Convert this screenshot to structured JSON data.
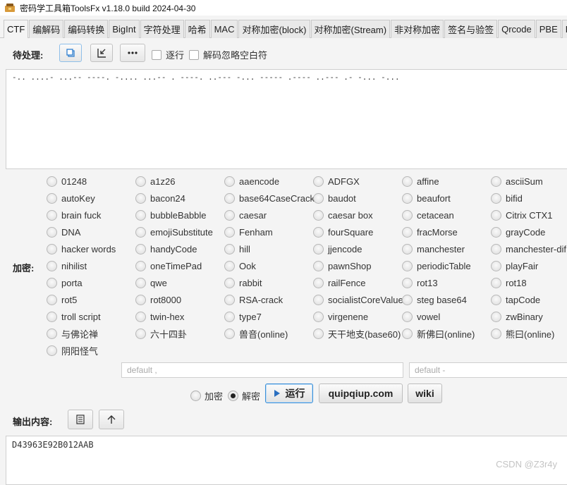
{
  "window": {
    "title": "密码学工具箱ToolsFx v1.18.0 build 2024-04-30"
  },
  "tabs": [
    "CTF",
    "编解码",
    "编码转换",
    "BigInt",
    "字符处理",
    "哈希",
    "MAC",
    "对称加密(block)",
    "对称加密(Stream)",
    "非对称加密",
    "签名与验签",
    "Qrcode",
    "PBE",
    "Brow"
  ],
  "input_section": {
    "label": "待处理:",
    "line_by_line_label": "逐行",
    "ignore_whitespace_label": "解码忽略空白符",
    "text": "-.. ....- ...-- ----. -.... ...-- . ----. ..--- -... ----- .---- ..--- .- -... -..."
  },
  "encrypt_label": "加密:",
  "algorithms": [
    [
      "01248",
      "a1z26",
      "aaencode",
      "ADFGX",
      "affine",
      "asciiSum"
    ],
    [
      "autoKey",
      "bacon24",
      "base64CaseCrack",
      "baudot",
      "beaufort",
      "bifid"
    ],
    [
      "brain fuck",
      "bubbleBabble",
      "caesar",
      "caesar box",
      "cetacean",
      "Citrix CTX1"
    ],
    [
      "DNA",
      "emojiSubstitute",
      "Fenham",
      "fourSquare",
      "fracMorse",
      "grayCode"
    ],
    [
      "hacker words",
      "handyCode",
      "hill",
      "jjencode",
      "manchester",
      "manchester-dif"
    ],
    [
      "nihilist",
      "oneTimePad",
      "Ook",
      "pawnShop",
      "periodicTable",
      "playFair"
    ],
    [
      "porta",
      "qwe",
      "rabbit",
      "railFence",
      "rot13",
      "rot18"
    ],
    [
      "rot5",
      "rot8000",
      "RSA-crack",
      "socialistCoreValue",
      "steg base64",
      "tapCode"
    ],
    [
      "troll script",
      "twin-hex",
      "type7",
      "virgenene",
      "vowel",
      "zwBinary"
    ],
    [
      "与佛论禅",
      "六十四卦",
      "兽音(online)",
      "天干地支(base60)",
      "新佛曰(online)",
      "熊曰(online)"
    ],
    [
      "阴阳怪气"
    ]
  ],
  "params": {
    "key_placeholder": "default ,",
    "key2_placeholder": "default -"
  },
  "mode": {
    "encrypt_label": "加密",
    "decrypt_label": "解密",
    "selected": "解密"
  },
  "buttons": {
    "run": "运行",
    "quipqiup": "quipqiup.com",
    "wiki": "wiki"
  },
  "output_section": {
    "label": "输出内容:",
    "text": "D43963E92B012AAB"
  },
  "watermark": "CSDN @Z3r4y"
}
